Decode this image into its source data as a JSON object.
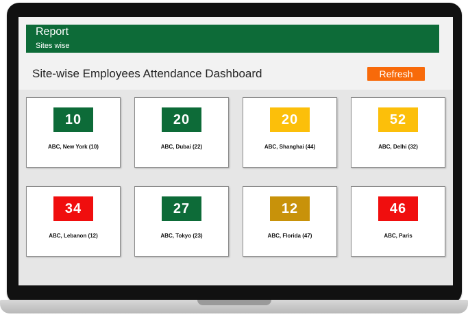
{
  "header": {
    "title": "Report",
    "subtitle": "Sites wise",
    "background": "#0d6b38"
  },
  "dashboard": {
    "title": "Site-wise Employees Attendance Dashboard",
    "refresh_label": "Refresh",
    "refresh_color": "#f86a0a"
  },
  "status_colors": {
    "green": "#0d6b38",
    "yellow": "#fcbf0a",
    "gold": "#c8920a",
    "red": "#f00e0e"
  },
  "sites": [
    {
      "count": "10",
      "name": "ABC, New York (10)",
      "status": "green"
    },
    {
      "count": "20",
      "name": "ABC, Dubai (22)",
      "status": "green"
    },
    {
      "count": "20",
      "name": "ABC, Shanghai (44)",
      "status": "yellow"
    },
    {
      "count": "52",
      "name": "ABC, Delhi (32)",
      "status": "yellow"
    },
    {
      "count": "34",
      "name": "ABC, Lebanon (12)",
      "status": "red"
    },
    {
      "count": "27",
      "name": "ABC, Tokyo (23)",
      "status": "green"
    },
    {
      "count": "12",
      "name": "ABC, Florida (47)",
      "status": "gold"
    },
    {
      "count": "46",
      "name": "ABC, Paris",
      "status": "red"
    }
  ]
}
